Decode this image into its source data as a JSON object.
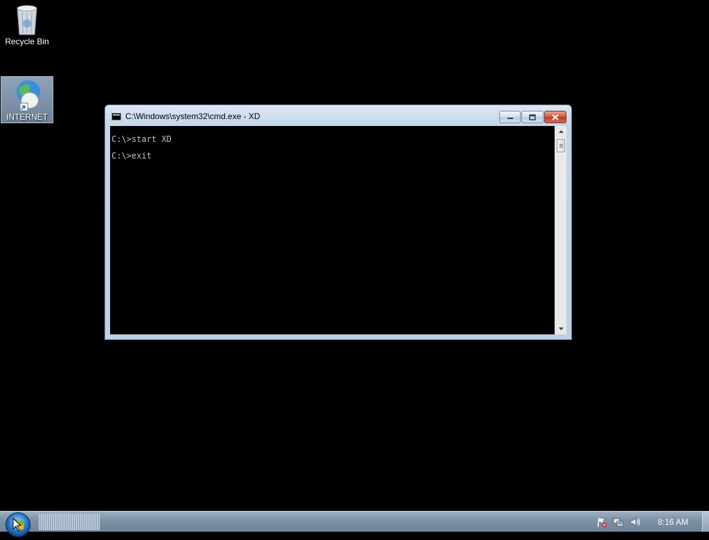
{
  "desktop": {
    "icons": [
      {
        "label": "Recycle Bin",
        "icon": "recycle-bin-icon"
      },
      {
        "label": "INTERNET",
        "icon": "internet-shortcut-icon",
        "selected": true
      }
    ]
  },
  "window": {
    "title": "C:\\Windows\\system32\\cmd.exe - XD",
    "icon": "cmd-icon",
    "console_lines": [
      "C:\\>start XD",
      "C:\\>exit"
    ],
    "buttons": {
      "minimize": "minimize-icon",
      "maximize": "maximize-icon",
      "close": "close-icon"
    }
  },
  "taskbar": {
    "start_icon": "windows-start-orb-icon",
    "tray_icons": [
      "action-center-flag-icon",
      "network-icon",
      "volume-icon"
    ],
    "clock": "8:16 AM"
  },
  "colors": {
    "desktop_background": "#000000",
    "console_background": "#000000",
    "console_text": "#c0c0c0",
    "window_frame": "#c3d6ea",
    "close_button": "#c23a22",
    "taskbar": "#7e93a8"
  }
}
